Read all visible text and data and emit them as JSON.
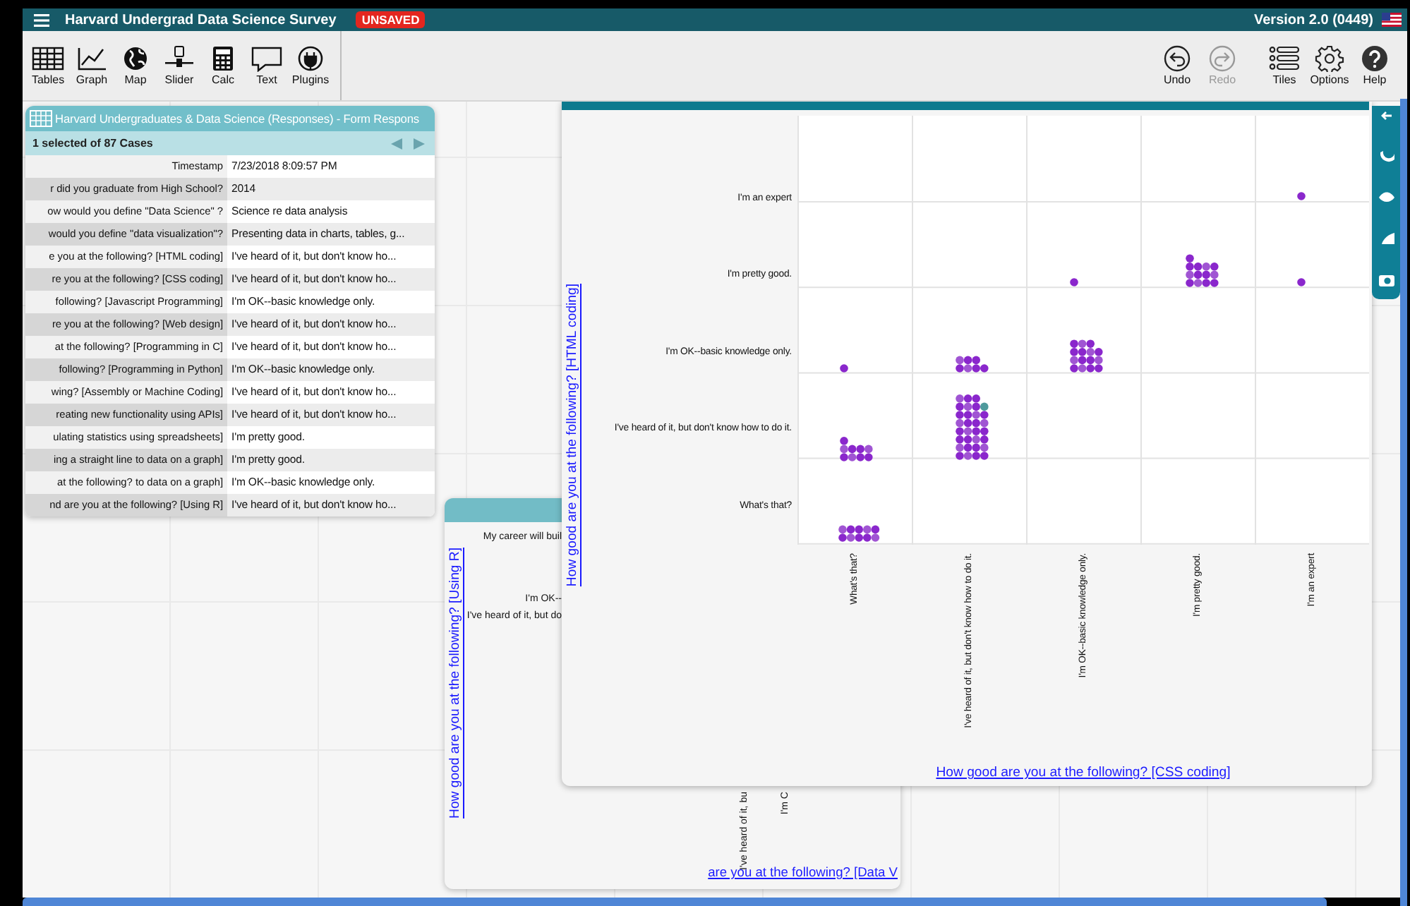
{
  "title_bar": {
    "title": "Harvard Undergrad Data Science Survey",
    "status": "UNSAVED",
    "version": "Version 2.0 (0449)"
  },
  "toolbar": {
    "tools": [
      {
        "label": "Tables",
        "kind": "tables"
      },
      {
        "label": "Graph",
        "kind": "graph"
      },
      {
        "label": "Map",
        "kind": "map"
      },
      {
        "label": "Slider",
        "kind": "slider"
      },
      {
        "label": "Calc",
        "kind": "calc"
      },
      {
        "label": "Text",
        "kind": "text"
      },
      {
        "label": "Plugins",
        "kind": "plugins"
      }
    ],
    "right_tools": [
      {
        "label": "Undo",
        "kind": "undo",
        "disabled": false
      },
      {
        "label": "Redo",
        "kind": "redo",
        "disabled": true
      },
      {
        "label": "Tiles",
        "kind": "tiles",
        "disabled": false
      },
      {
        "label": "Options",
        "kind": "options",
        "disabled": false
      },
      {
        "label": "Help",
        "kind": "help",
        "disabled": false
      }
    ]
  },
  "case_table": {
    "title": "Harvard Undergraduates & Data Science (Responses) - Form Respons",
    "summary": "1 selected of 87 Cases",
    "rows": [
      {
        "attribute": "Timestamp",
        "value": "7/23/2018 8:09:57 PM"
      },
      {
        "attribute": "r did you graduate from High School?",
        "value": "2014"
      },
      {
        "attribute": "ow would you define \"Data Science\" ?",
        "value": "Science re data analysis"
      },
      {
        "attribute": "would you define \"data visualization\"?",
        "value": "Presenting data in charts, tables, g..."
      },
      {
        "attribute": "e you at the following? [HTML coding]",
        "value": "I've heard of it, but don't know ho..."
      },
      {
        "attribute": "re you at the following? [CSS coding]",
        "value": "I've heard of it, but don't know ho..."
      },
      {
        "attribute": "following? [Javascript Programming]",
        "value": "I'm OK--basic knowledge only."
      },
      {
        "attribute": "re you at the following? [Web design]",
        "value": "I've heard of it, but don't know ho..."
      },
      {
        "attribute": "at the following? [Programming in C]",
        "value": "I've heard of it, but don't know ho..."
      },
      {
        "attribute": "following? [Programming in Python]",
        "value": "I'm OK--basic knowledge only."
      },
      {
        "attribute": "wing? [Assembly or Machine Coding]",
        "value": "I've heard of it, but don't know ho..."
      },
      {
        "attribute": "reating new functionality using APIs]",
        "value": "I've heard of it, but don't know ho..."
      },
      {
        "attribute": "ulating statistics using spreadsheets]",
        "value": "I'm pretty good."
      },
      {
        "attribute": "ing a straight line to data on a graph]",
        "value": "I'm pretty good."
      },
      {
        "attribute": "at the following? to data on a graph]",
        "value": "I'm OK--basic knowledge only."
      },
      {
        "attribute": "nd are you at the following? [Using R]",
        "value": "I've heard of it, but don't know ho..."
      }
    ]
  },
  "back_graph": {
    "y_axis_title": "How good are you at the following? [Using R]",
    "y_labels": [
      "My career will buil",
      "I'm OK--",
      "I've heard of it, but do"
    ],
    "x_labels": [
      "I've heard of it, bu",
      "I'm C"
    ],
    "x_axis_title": "are you at the following? [Data V"
  },
  "front_graph": {
    "y_axis_title": "How good are you at the following? [HTML coding]",
    "y_categories": [
      "I'm an expert",
      "I'm pretty good.",
      "I'm OK--basic knowledge only.",
      "I've heard of it, but don't know how to do it.",
      "What's that?"
    ],
    "x_categories": [
      "What's that?",
      "I've heard of it, but don't know how to do it.",
      "I'm OK--basic knowledge only.",
      "I'm pretty good.",
      "I'm an expert"
    ],
    "x_axis_title": "How good are you at the following? [CSS coding]"
  }
}
